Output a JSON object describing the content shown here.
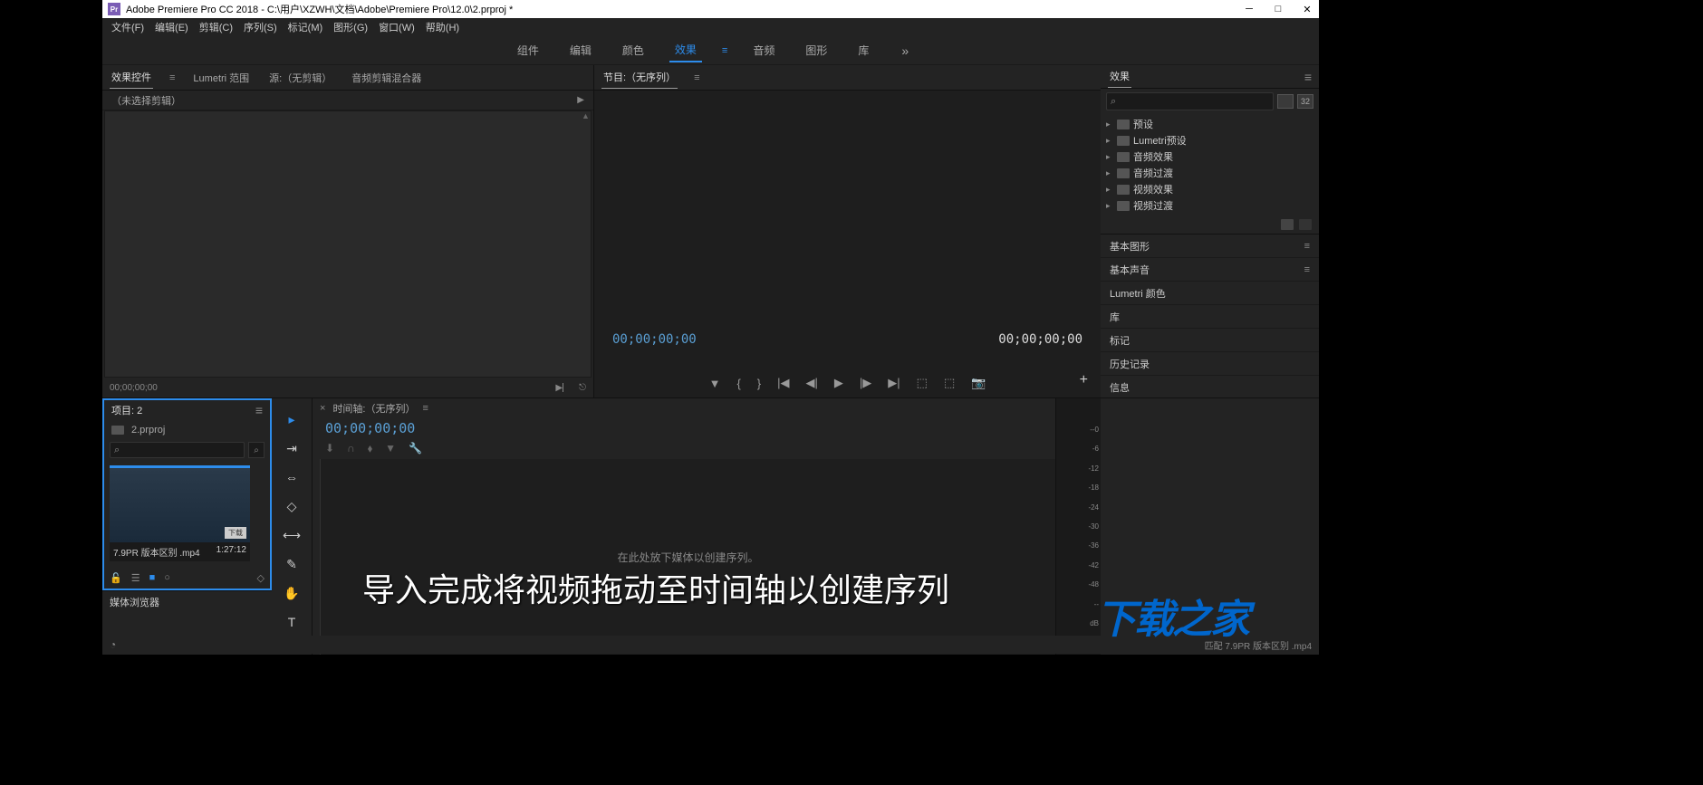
{
  "titlebar": {
    "icon_text": "Pr",
    "title": "Adobe Premiere Pro CC 2018 - C:\\用户\\XZWH\\文档\\Adobe\\Premiere Pro\\12.0\\2.prproj *"
  },
  "menubar": [
    "文件(F)",
    "编辑(E)",
    "剪辑(C)",
    "序列(S)",
    "标记(M)",
    "图形(G)",
    "窗口(W)",
    "帮助(H)"
  ],
  "workspaces": {
    "items": [
      "组件",
      "编辑",
      "颜色",
      "效果",
      "音频",
      "图形",
      "库"
    ],
    "active_index": 3,
    "more": "»"
  },
  "effect_controls": {
    "tabs": [
      "效果控件",
      "Lumetri 范围",
      "源:（无剪辑）",
      "音频剪辑混合器"
    ],
    "active_index": 0,
    "no_selection": "（未选择剪辑）",
    "timecode": "00;00;00;00"
  },
  "program": {
    "title": "节目:（无序列）",
    "timecode_left": "00;00;00;00",
    "timecode_right": "00;00;00;00"
  },
  "effects_panel": {
    "title": "效果",
    "search_icon": "⌕",
    "badges": [
      "",
      "32"
    ],
    "tree": [
      "预设",
      "Lumetri预设",
      "音频效果",
      "音频过渡",
      "视频效果",
      "视频过渡"
    ]
  },
  "right_accordion": [
    "基本图形",
    "基本声音",
    "Lumetri 颜色",
    "库",
    "标记",
    "历史记录",
    "信息"
  ],
  "project": {
    "title": "项目: 2",
    "crumb": "2.prproj",
    "thumb": {
      "name": "7.9PR 版本区别 .mp4",
      "duration": "1:27:12",
      "badge": "下载"
    }
  },
  "media_browser": "媒体浏览器",
  "tools": [
    "▸",
    "⇥",
    "⇔",
    "◇",
    "⟷",
    "✎",
    "✋",
    "T"
  ],
  "timeline": {
    "title": "时间轴:（无序列）",
    "timecode": "00;00;00;00",
    "placeholder": "在此处放下媒体以创建序列。"
  },
  "audio_meter_labels": [
    "--0",
    "-6",
    "-12",
    "-18",
    "-24",
    "-30",
    "-36",
    "-42",
    "-48",
    "--",
    "dB"
  ],
  "subtitle": "导入完成将视频拖动至时间轴以创建序列",
  "watermark": "下载之家",
  "status": {
    "right": "匹配 7.9PR 版本区别 .mp4"
  }
}
